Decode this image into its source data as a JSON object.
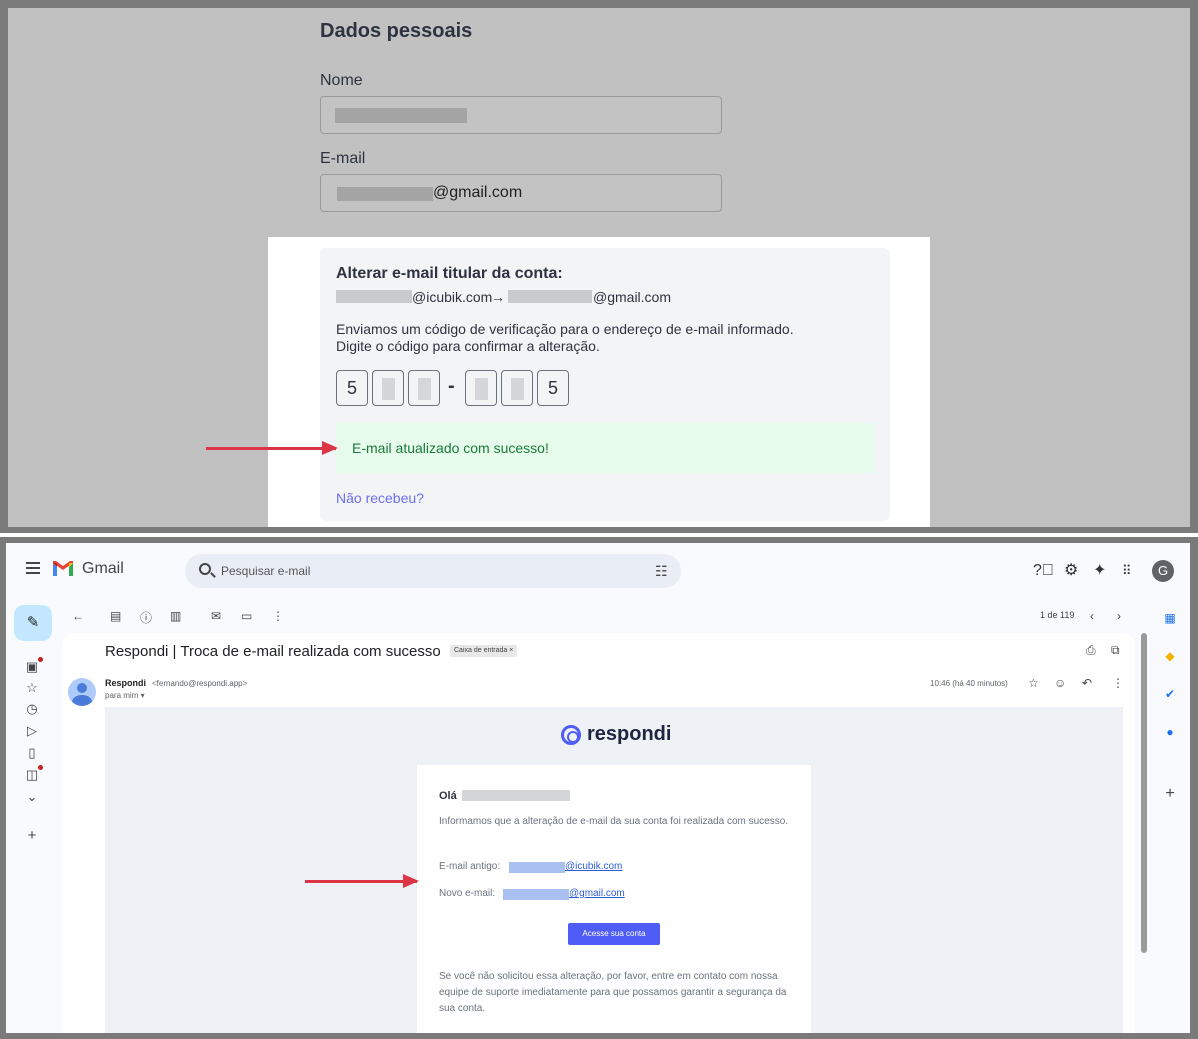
{
  "form": {
    "title": "Dados pessoais",
    "name_label": "Nome",
    "email_label": "E-mail",
    "email_value": "@gmail.com"
  },
  "change": {
    "title": "Alterar e-mail titular da conta:",
    "old_domain": "@icubik.com",
    "arrow": "→",
    "new_domain": "@gmail.com",
    "message_line1": "Enviamos um código de verificação para o endereço de e-mail informado.",
    "message_line2": "Digite o código para confirmar a alteração.",
    "code_first": "5",
    "code_dash": "-",
    "code_last": "5",
    "success": "E-mail atualizado com sucesso!",
    "resend": "Não recebeu?"
  },
  "gmail": {
    "app_name": "Gmail",
    "search_placeholder": "Pesquisar e-mail",
    "avatar_letter": "G",
    "page_count": "1 de 119",
    "subject": "Respondi | Troca de e-mail realizada com sucesso",
    "inbox_badge": "Caixa de entrada ×",
    "sender_name": "Respondi",
    "sender_email": "<fernando@respondi.app>",
    "to_line": "para mim ▾",
    "time": "10:46 (há 40 minutos)"
  },
  "email": {
    "logo_text": "respondi",
    "greeting": "Olá",
    "info": "Informamos que a alteração de e-mail da sua conta foi realizada com sucesso.",
    "old_label": "E-mail antigo:",
    "old_domain": "@icubik.com",
    "new_label": "Novo e-mail:",
    "new_domain": "@gmail.com",
    "cta": "Acesse sua conta",
    "disclaimer": "Se você não solicitou essa alteração, por favor, entre em contato com nossa equipe de suporte imediatamente para que possamos garantir a segurança da sua conta."
  },
  "colors": {
    "accent": "#4f5df7",
    "success_bg": "#e6fbeb",
    "success_text": "#1a7a3a",
    "annotation_arrow": "#dc3545"
  },
  "icons": [
    "menu-icon",
    "search-icon",
    "filter-icon",
    "help-icon",
    "settings-icon",
    "gemini-icon",
    "apps-icon",
    "compose-pencil-icon",
    "back-arrow-icon",
    "archive-icon",
    "report-icon",
    "delete-icon",
    "mark-unread-icon",
    "move-icon",
    "more-vert-icon",
    "print-icon",
    "open-new-window-icon",
    "star-icon",
    "emoji-icon",
    "reply-icon",
    "plus-icon"
  ]
}
